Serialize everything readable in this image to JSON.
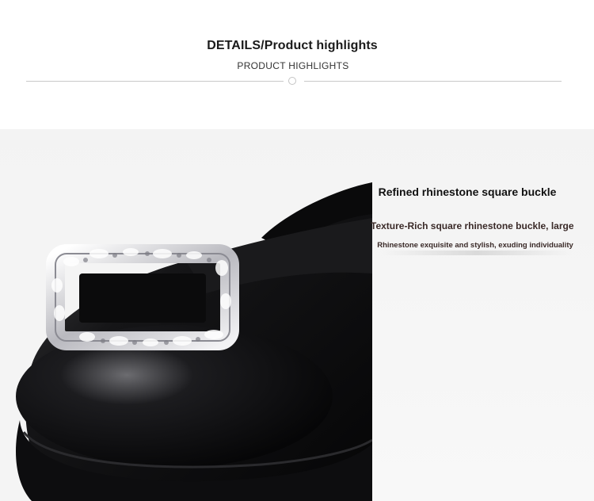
{
  "header": {
    "title": "DETAILS/Product highlights",
    "subtitle": "PRODUCT HIGHLIGHTS"
  },
  "feature": {
    "title": "Refined rhinestone square buckle",
    "line1": "Texture-Rich square rhinestone buckle, large",
    "line2": "Rhinestone exquisite and stylish, exuding individuality"
  },
  "colors": {
    "background_top": "#ffffff",
    "background_content": "#f4f4f4",
    "shoe": "#0c0c0e",
    "text_dark": "#1a1a1a",
    "text_brown": "#3a2a28"
  },
  "icons": {
    "divider_ornament": "circle-icon"
  }
}
